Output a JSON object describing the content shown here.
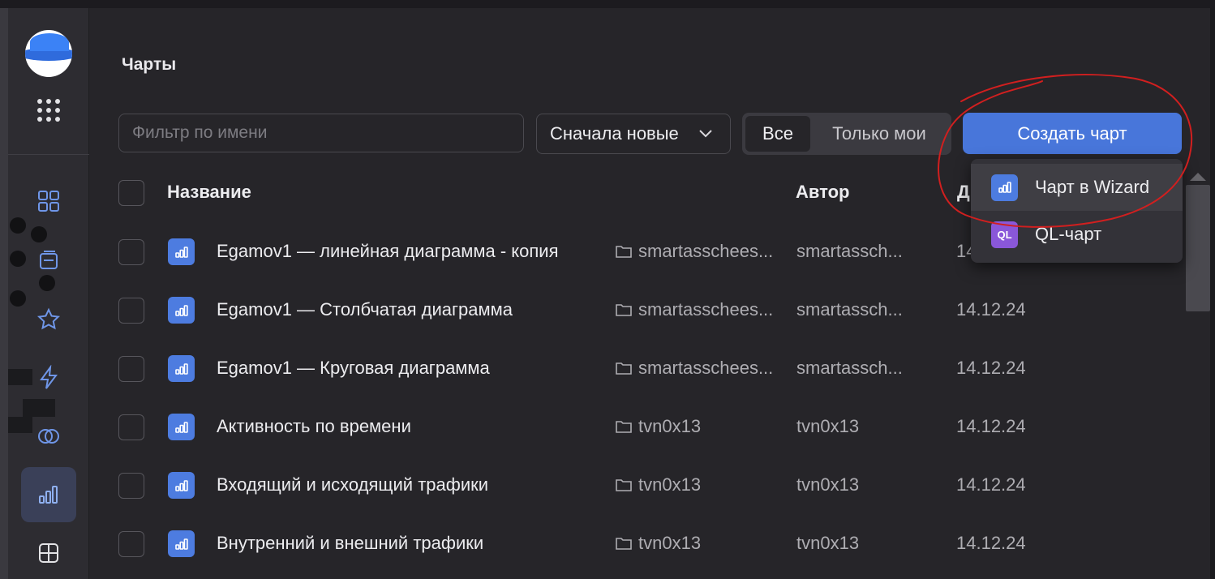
{
  "page": {
    "title": "Чарты"
  },
  "toolbar": {
    "filter_placeholder": "Фильтр по имени",
    "sort_label": "Сначала новые",
    "segment_all": "Все",
    "segment_mine": "Только мои",
    "create_label": "Создать чарт"
  },
  "table": {
    "headers": {
      "name": "Название",
      "author": "Автор",
      "date": "Д"
    },
    "rows": [
      {
        "name": "Egamov1 — линейная диаграмма - копия",
        "folder": "smartasschees...",
        "author": "smartassch...",
        "date": "14"
      },
      {
        "name": "Egamov1 — Столбчатая диаграмма",
        "folder": "smartasschees...",
        "author": "smartassch...",
        "date": "14.12.24"
      },
      {
        "name": "Egamov1 — Круговая диаграмма",
        "folder": "smartasschees...",
        "author": "smartassch...",
        "date": "14.12.24"
      },
      {
        "name": "Активность по времени",
        "folder": "tvn0x13",
        "author": "tvn0x13",
        "date": "14.12.24"
      },
      {
        "name": "Входящий и исходящий трафики",
        "folder": "tvn0x13",
        "author": "tvn0x13",
        "date": "14.12.24"
      },
      {
        "name": "Внутренний и внешний трафики",
        "folder": "tvn0x13",
        "author": "tvn0x13",
        "date": "14.12.24"
      }
    ]
  },
  "dropdown": {
    "items": [
      {
        "label": "Чарт в Wizard",
        "icon": "chart-bar-icon"
      },
      {
        "label": "QL-чарт",
        "icon_text": "QL"
      }
    ]
  },
  "colors": {
    "accent": "#4876da",
    "background": "#262529",
    "rail": "#2d2c31",
    "ql": "#8a57d9",
    "annotation": "#d11f1f"
  }
}
